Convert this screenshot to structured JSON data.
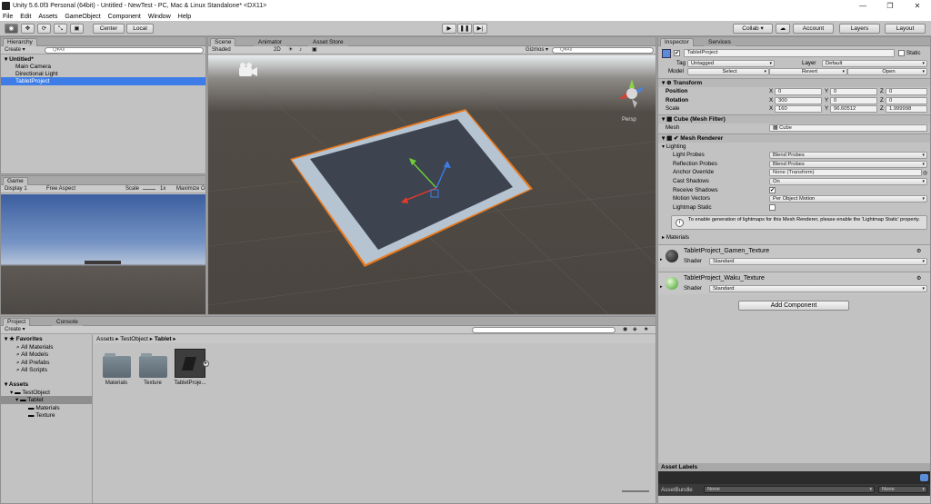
{
  "title_bar": {
    "text": "Unity 5.6.0f3 Personal (64bit) - Untitled - NewTest - PC, Mac & Linux Standalone* <DX11>",
    "minimize": "—",
    "maximize": "❐",
    "close": "✕"
  },
  "menu": [
    "File",
    "Edit",
    "Assets",
    "GameObject",
    "Component",
    "Window",
    "Help"
  ],
  "toolbar": {
    "pivot": "Center",
    "space": "Local",
    "collab": "Collab ▾",
    "account": "Account",
    "layers": "Layers",
    "layout": "Layout"
  },
  "hierarchy": {
    "tab": "Hierarchy",
    "create": "Create ▾",
    "search_placeholder": "Q▾All",
    "scene": "Untitled*",
    "items": [
      "Main Camera",
      "Directional Light",
      "TabletProject"
    ]
  },
  "scene": {
    "tabs": [
      "Scene",
      "Animator",
      "Asset Store"
    ],
    "shading": "Shaded",
    "mode_2d": "2D",
    "gizmos": "Gizmos ▾",
    "search_placeholder": "Q▾All",
    "persp": "Persp"
  },
  "game": {
    "tab": "Game",
    "display": "Display 1",
    "aspect": "Free Aspect",
    "scale_label": "Scale",
    "scale_value": "1x",
    "maximize": "Maximize O"
  },
  "project": {
    "tabs": [
      "Project",
      "Console"
    ],
    "create": "Create ▾",
    "favorites_label": "Favorites",
    "favorites": [
      "All Materials",
      "All Models",
      "All Prefabs",
      "All Scripts"
    ],
    "assets_label": "Assets",
    "tree": [
      "TestObject",
      "Tablet",
      "Materials",
      "Texture"
    ],
    "breadcrumb": [
      "Assets",
      "TestObject",
      "Tablet"
    ],
    "files": [
      "Materials",
      "Texture",
      "TabletProje..."
    ]
  },
  "inspector": {
    "tabs": [
      "Inspector",
      "Services"
    ],
    "object_name": "TabletProject",
    "static_label": "Static",
    "tag_label": "Tag",
    "tag_value": "Untagged",
    "layer_label": "Layer",
    "layer_value": "Default",
    "model_label": "Model",
    "model_buttons": [
      "Select",
      "Revert",
      "Open"
    ],
    "transform": {
      "title": "Transform",
      "rows": [
        {
          "label": "Position",
          "x": "0",
          "y": "0",
          "z": "0"
        },
        {
          "label": "Rotation",
          "x": "300",
          "y": "0",
          "z": "0"
        },
        {
          "label": "Scale",
          "x": "160",
          "y": "96.60512",
          "z": "1.999998"
        }
      ]
    },
    "mesh_filter": {
      "title": "Cube (Mesh Filter)",
      "mesh_label": "Mesh",
      "mesh_value": "Cube"
    },
    "mesh_renderer": {
      "title": "Mesh Renderer",
      "lighting": "Lighting",
      "rows": [
        {
          "label": "Light Probes",
          "value": "Blend Probes"
        },
        {
          "label": "Reflection Probes",
          "value": "Blend Probes"
        },
        {
          "label": "Anchor Override",
          "value": "None (Transform)"
        },
        {
          "label": "Cast Shadows",
          "value": "On"
        },
        {
          "label": "Receive Shadows",
          "value": "✔"
        },
        {
          "label": "Motion Vectors",
          "value": "Per Object Motion"
        },
        {
          "label": "Lightmap Static",
          "value": ""
        }
      ],
      "info": "To enable generation of lightmaps for this Mesh Renderer, please enable the 'Lightmap Static' property.",
      "materials": "Materials"
    },
    "materials": [
      {
        "name": "TabletProject_Gamen_Texture",
        "shader_label": "Shader",
        "shader": "Standard"
      },
      {
        "name": "TabletProject_Waku_Texture",
        "shader_label": "Shader",
        "shader": "Standard"
      }
    ],
    "add_component": "Add Component",
    "asset_labels": "Asset Labels",
    "asset_bundle_label": "AssetBundle",
    "asset_bundle_value": "None",
    "asset_bundle_variant": "None"
  },
  "colors": {
    "selection": "#3e7de7",
    "accent_orange": "#f07a1e"
  }
}
